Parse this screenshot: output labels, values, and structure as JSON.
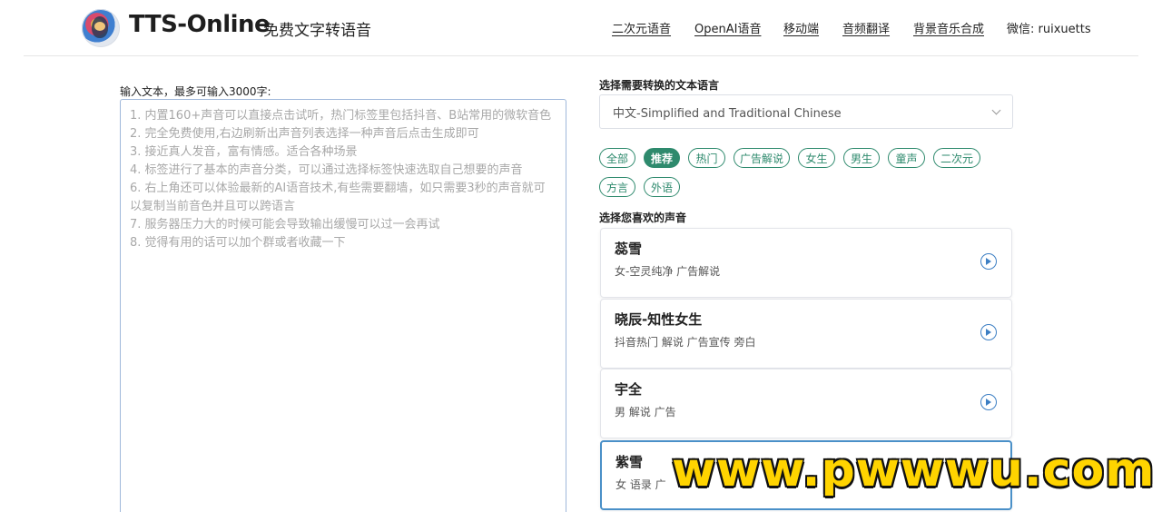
{
  "header": {
    "brand": "TTS-Online",
    "subtitle": "免费文字转语音",
    "nav": [
      {
        "label": "二次元语音"
      },
      {
        "label": "OpenAI语音"
      },
      {
        "label": "移动端"
      },
      {
        "label": "音频翻译"
      },
      {
        "label": "背景音乐合成"
      },
      {
        "label": "微信: ruixuetts"
      }
    ]
  },
  "input": {
    "label": "输入文本，最多可输入3000字:",
    "placeholder_lines": [
      "1. 内置160+声音可以直接点击试听，热门标签里包括抖音、B站常用的微软音色",
      "2. 完全免费使用,右边刷新出声音列表选择一种声音后点击生成即可",
      "3. 接近真人发音，富有情感。适合各种场景",
      "4. 标签进行了基本的声音分类，可以通过选择标签快速选取自己想要的声音",
      "6. 右上角还可以体验最新的AI语音技术,有些需要翻墙，如只需要3秒的声音就可以复制当前音色并且可以跨语言",
      "7. 服务器压力大的时候可能会导致输出缓慢可以过一会再试",
      "8. 觉得有用的话可以加个群或者收藏一下"
    ]
  },
  "language": {
    "label": "选择需要转换的文本语言",
    "selected": "中文-Simplified and Traditional Chinese"
  },
  "tags": [
    {
      "label": "全部",
      "active": false
    },
    {
      "label": "推荐",
      "active": true
    },
    {
      "label": "热门",
      "active": false
    },
    {
      "label": "广告解说",
      "active": false
    },
    {
      "label": "女生",
      "active": false
    },
    {
      "label": "男生",
      "active": false
    },
    {
      "label": "童声",
      "active": false
    },
    {
      "label": "二次元",
      "active": false
    },
    {
      "label": "方言",
      "active": false
    },
    {
      "label": "外语",
      "active": false
    }
  ],
  "voices": {
    "label": "选择您喜欢的声音",
    "items": [
      {
        "name": "蕊雪",
        "desc": "女-空灵纯净 广告解说"
      },
      {
        "name": "晓辰-知性女生",
        "desc": "抖音热门 解说 广告宣传 旁白"
      },
      {
        "name": "宇全",
        "desc": "男 解说 广告"
      },
      {
        "name": "紫雪",
        "desc": "女 语录 广"
      }
    ]
  },
  "watermark": "www.pwwwu.com",
  "colors": {
    "accent": "#2e8a6d",
    "play": "#3d7fc4",
    "watermark": "#ffd400"
  }
}
